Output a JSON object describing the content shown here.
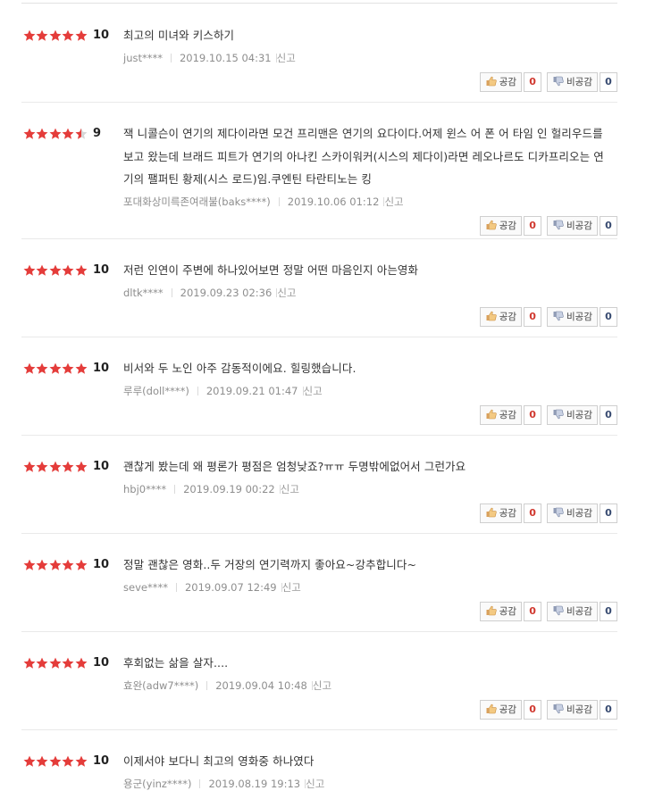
{
  "colors": {
    "star_full": "#e43c3a",
    "star_empty": "#d6d6d6",
    "like_count": "#d0372e",
    "dislike_count": "#374a70"
  },
  "labels": {
    "like": "공감",
    "dislike": "비공감",
    "report": "신고"
  },
  "reviews": [
    {
      "rating": 5,
      "score": "10",
      "comment": "최고의 미녀와 키스하기",
      "user": "just****",
      "date": "2019.10.15 04:31",
      "likes": "0",
      "dislikes": "0"
    },
    {
      "rating": 4.5,
      "score": "9",
      "comment": "잭 니콜슨이 연기의 제다이라면 모건 프리맨은 연기의 요다이다.어제 윈스 어 폰 어 타임 인 헐리우드를 보고 왔는데 브래드 피트가 연기의 아나킨 스카이워커(시스의 제다이)라면 레오나르도 디카프리오는 연기의 팰퍼틴 황제(시스 로드)임.쿠엔틴 타란티노는 킹",
      "user": "포대화상미륵존여래불(baks****)",
      "date": "2019.10.06 01:12",
      "likes": "0",
      "dislikes": "0"
    },
    {
      "rating": 5,
      "score": "10",
      "comment": "저런 인연이 주변에 하나있어보면 정말 어떤 마음인지 아는영화",
      "user": "dltk****",
      "date": "2019.09.23 02:36",
      "likes": "0",
      "dislikes": "0"
    },
    {
      "rating": 5,
      "score": "10",
      "comment": "비서와 두 노인 아주 감동적이에요. 힐링했습니다.",
      "user": "루루(doll****)",
      "date": "2019.09.21 01:47",
      "likes": "0",
      "dislikes": "0"
    },
    {
      "rating": 5,
      "score": "10",
      "comment": "괜찮게 봤는데 왜 평론가 평점은 엄청낮죠?ㅠㅠ 두명밖에없어서 그런가요",
      "user": "hbj0****",
      "date": "2019.09.19 00:22",
      "likes": "0",
      "dislikes": "0"
    },
    {
      "rating": 5,
      "score": "10",
      "comment": "정말 괜찮은 영화..두 거장의 연기력까지 좋아요~강추합니다~",
      "user": "seve****",
      "date": "2019.09.07 12:49",
      "likes": "0",
      "dislikes": "0"
    },
    {
      "rating": 5,
      "score": "10",
      "comment": "후회없는 삶을 살자....",
      "user": "효완(adw7****)",
      "date": "2019.09.04 10:48",
      "likes": "0",
      "dislikes": "0"
    },
    {
      "rating": 5,
      "score": "10",
      "comment": "이제서야 보다니 최고의 영화중 하나였다",
      "user": "용군(yinz****)",
      "date": "2019.08.19 19:13",
      "likes": null,
      "dislikes": null
    }
  ]
}
